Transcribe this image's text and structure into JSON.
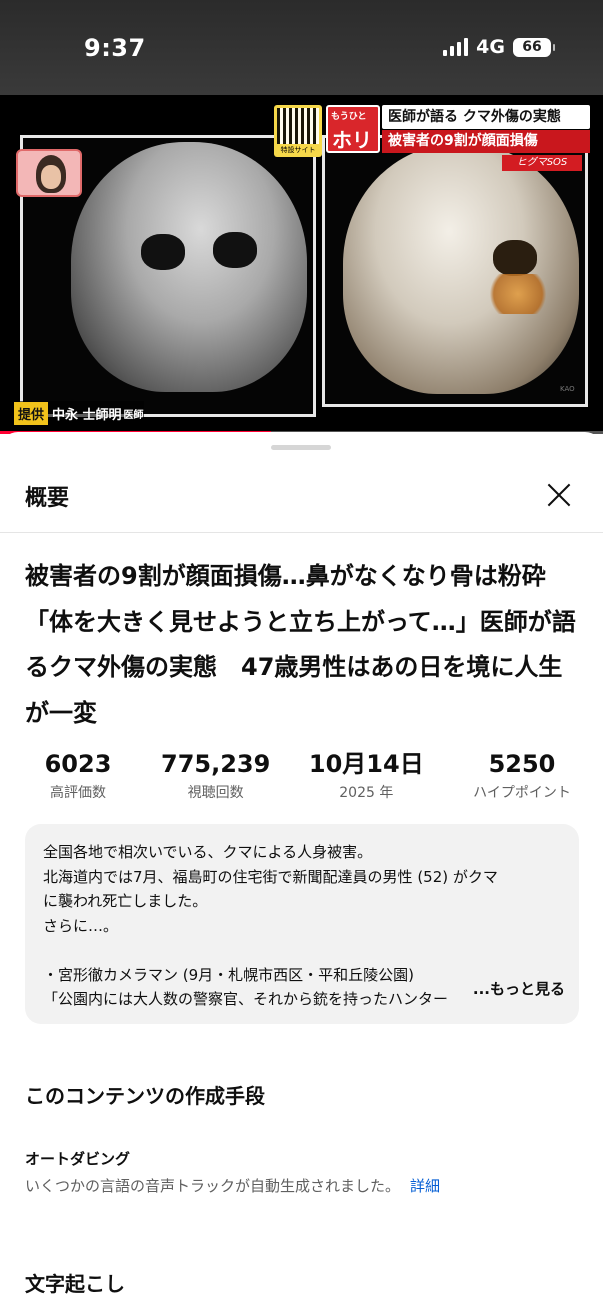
{
  "status_bar": {
    "time": "9:37",
    "network": "4G",
    "battery": "66"
  },
  "video": {
    "qr_label": "特設サイト",
    "banner_tag_small": "もうひと",
    "banner_tag_big": "ホリ",
    "banner_line1": "医師が語る クマ外傷の実態",
    "banner_line2": "被害者の9割が顔面損傷",
    "brand_tag": "ヒグマSOS",
    "credit_tag": "提供",
    "credit_name": "中永 士師明",
    "credit_suffix": "医師",
    "watermark": "KAO",
    "progress": 0.45
  },
  "sheet": {
    "title": "概要",
    "close_icon": "close-icon",
    "video_title": "被害者の9割が顔面損傷…鼻がなくなり骨は粉砕「体を大きく見せようと立ち上がって…」医師が語るクマ外傷の実態　47歳男性はあの日を境に人生が一変",
    "stats": [
      {
        "value": "6023",
        "label": "高評価数"
      },
      {
        "value": "775,239",
        "label": "視聴回数"
      },
      {
        "value": "10月14日",
        "label": "2025 年"
      },
      {
        "value": "5250",
        "label": "ハイプポイント"
      }
    ],
    "description": {
      "lines": [
        "全国各地で相次いでいる、クマによる人身被害。",
        "北海道内では7月、福島町の住宅街で新聞配達員の男性 (52) がクマ",
        "に襲われ死亡しました。",
        "さらに…。",
        "",
        "・宮形徹カメラマン (9月・札幌市西区・平和丘陵公園)",
        "「公園内には大人数の警察官、それから銃を持ったハンター"
      ],
      "more": "...もっと見る"
    },
    "creation_section": {
      "heading": "このコンテンツの作成手段",
      "item_title": "オートダビング",
      "item_text": "いくつかの言語の音声トラックが自動生成されました。",
      "item_link": "詳細"
    },
    "transcript_heading": "文字起こし"
  }
}
